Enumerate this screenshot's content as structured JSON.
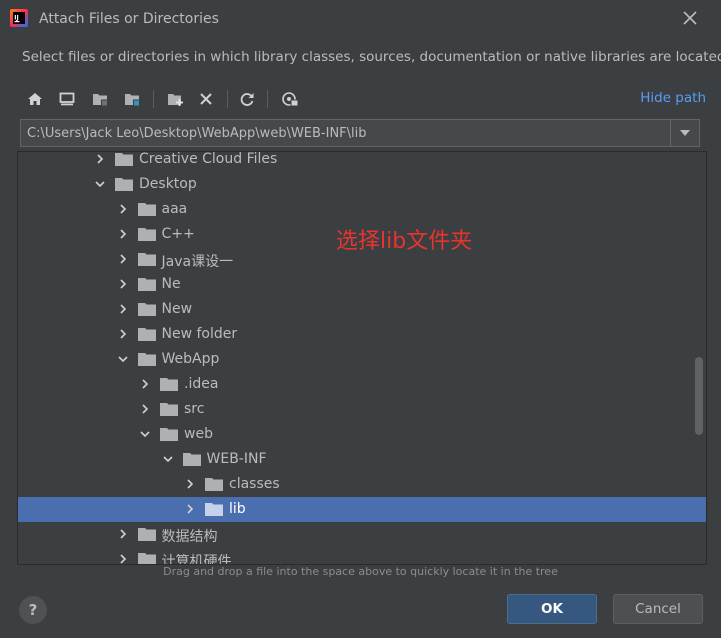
{
  "dialog": {
    "title": "Attach Files or Directories",
    "description": "Select files or directories in which library classes, sources, documentation or native libraries are located"
  },
  "toolbar": {
    "icons": [
      "home-icon",
      "desktop-icon",
      "project-folder-icon",
      "module-folder-icon",
      "new-folder-icon",
      "delete-icon",
      "refresh-icon",
      "show-hidden-icon"
    ],
    "hide_path_label": "Hide path"
  },
  "path": {
    "value": "C:\\Users\\Jack Leo\\Desktop\\WebApp\\web\\WEB-INF\\lib"
  },
  "tree": {
    "items": [
      {
        "label": "Creative Cloud Files",
        "depth": 0,
        "expanded": false,
        "selected": false
      },
      {
        "label": "Desktop",
        "depth": 0,
        "expanded": true,
        "selected": false
      },
      {
        "label": "aaa",
        "depth": 1,
        "expanded": false,
        "selected": false
      },
      {
        "label": "C++",
        "depth": 1,
        "expanded": false,
        "selected": false
      },
      {
        "label": "Java课设一",
        "depth": 1,
        "expanded": false,
        "selected": false
      },
      {
        "label": "Ne",
        "depth": 1,
        "expanded": false,
        "selected": false
      },
      {
        "label": "New",
        "depth": 1,
        "expanded": false,
        "selected": false
      },
      {
        "label": "New folder",
        "depth": 1,
        "expanded": false,
        "selected": false
      },
      {
        "label": "WebApp",
        "depth": 1,
        "expanded": true,
        "selected": false
      },
      {
        "label": ".idea",
        "depth": 2,
        "expanded": false,
        "selected": false
      },
      {
        "label": "src",
        "depth": 2,
        "expanded": false,
        "selected": false
      },
      {
        "label": "web",
        "depth": 2,
        "expanded": true,
        "selected": false
      },
      {
        "label": "WEB-INF",
        "depth": 3,
        "expanded": true,
        "selected": false
      },
      {
        "label": "classes",
        "depth": 4,
        "expanded": false,
        "selected": false
      },
      {
        "label": "lib",
        "depth": 4,
        "expanded": false,
        "selected": true
      },
      {
        "label": "数据结构",
        "depth": 1,
        "expanded": false,
        "selected": false
      },
      {
        "label": "计算机硬件",
        "depth": 1,
        "expanded": false,
        "selected": false
      }
    ]
  },
  "annotation": {
    "text": "选择lib文件夹",
    "color": "#e8342d"
  },
  "footer": {
    "hint": "Drag and drop a file into the space above to quickly locate it in the tree",
    "help_label": "?",
    "ok_label": "OK",
    "cancel_label": "Cancel"
  },
  "colors": {
    "background": "#3c3f41",
    "selection": "#4b6eaf",
    "link": "#589df6",
    "primary_button": "#365880"
  }
}
